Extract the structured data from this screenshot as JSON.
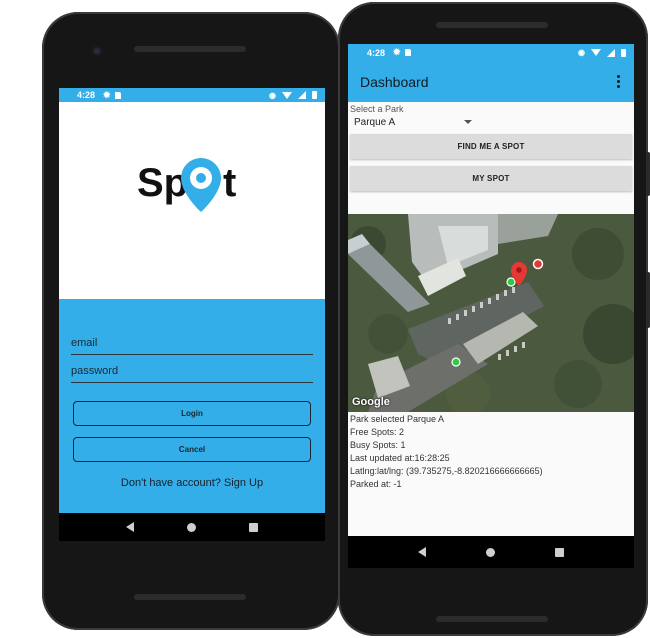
{
  "login_screen": {
    "status_time": "4:28",
    "logo_text": "Spot",
    "email_placeholder": "email",
    "password_placeholder": "password",
    "login_label": "Login",
    "cancel_label": "Cancel",
    "signup_text": "Don't have account? Sign Up"
  },
  "dashboard_screen": {
    "status_time": "4:28",
    "title": "Dashboard",
    "select_label": "Select a Park",
    "selected_park": "Parque A",
    "find_button": "FIND ME A SPOT",
    "my_spot_button": "MY SPOT",
    "map_attribution": "Google",
    "info": {
      "park_selected": "Park selected Parque A",
      "free_spots": "Free Spots: 2",
      "busy_spots": "Busy Spots: 1",
      "last_updated": "Last updated at:16:28:25",
      "latlng": "Latlng:lat/lng: (39.735275,-8.820216666666665)",
      "parked_at": "Parked at: -1"
    }
  },
  "colors": {
    "primary": "#34aee9",
    "phone_body": "#161616",
    "button_grey": "#dcdcdc",
    "marker_red": "#e53935",
    "marker_green": "#2ecc40"
  },
  "icons": [
    "settings-icon",
    "sd-card-icon",
    "location-icon",
    "wifi-icon",
    "signal-icon",
    "battery-icon",
    "overflow-menu-icon",
    "map-pin-icon",
    "back-icon",
    "home-icon",
    "recent-apps-icon"
  ]
}
